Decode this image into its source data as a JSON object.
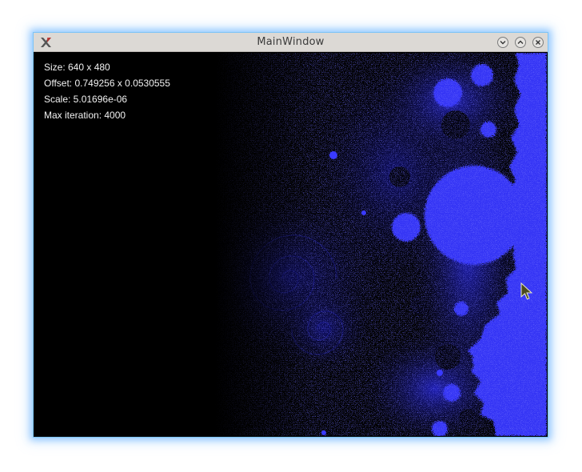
{
  "window": {
    "title": "MainWindow"
  },
  "info": {
    "size": "Size: 640 x 480",
    "offset": "Offset: 0.749256 x 0.0530555",
    "scale": "Scale: 5.01696e-06",
    "max_iteration": "Max iteration: 4000"
  },
  "icons": {
    "app": "x-app-icon",
    "minimize": "chevron-down-icon",
    "maximize": "chevron-up-icon",
    "close": "close-icon",
    "cursor": "arrow-cursor-icon"
  },
  "colors": {
    "fractal_blue": "#3333ff",
    "background": "#020204",
    "titlebar": "#dcd9d5",
    "text": "#f2f2f2"
  }
}
